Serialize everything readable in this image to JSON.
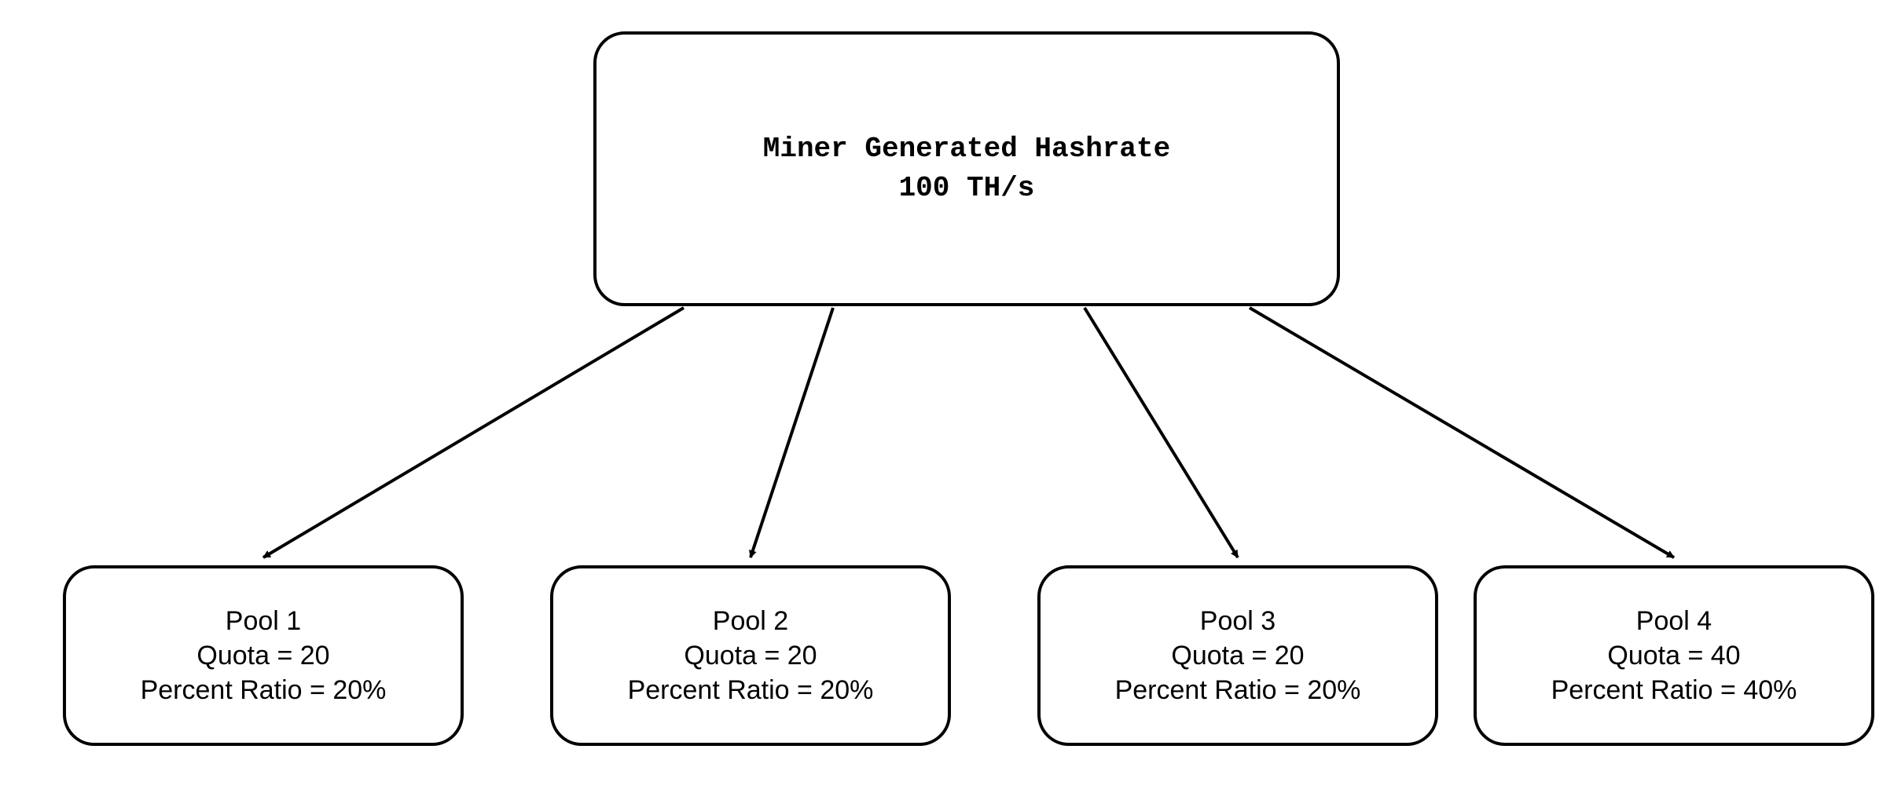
{
  "root": {
    "title": "Miner Generated Hashrate",
    "value": "100 TH/s"
  },
  "pools": [
    {
      "name": "Pool 1",
      "quota_label": "Quota = 20",
      "ratio_label": "Percent Ratio = 20%"
    },
    {
      "name": "Pool 2",
      "quota_label": "Quota = 20",
      "ratio_label": "Percent Ratio = 20%"
    },
    {
      "name": "Pool 3",
      "quota_label": "Quota = 20",
      "ratio_label": "Percent Ratio = 20%"
    },
    {
      "name": "Pool 4",
      "quota_label": "Quota = 40",
      "ratio_label": "Percent Ratio = 40%"
    }
  ]
}
